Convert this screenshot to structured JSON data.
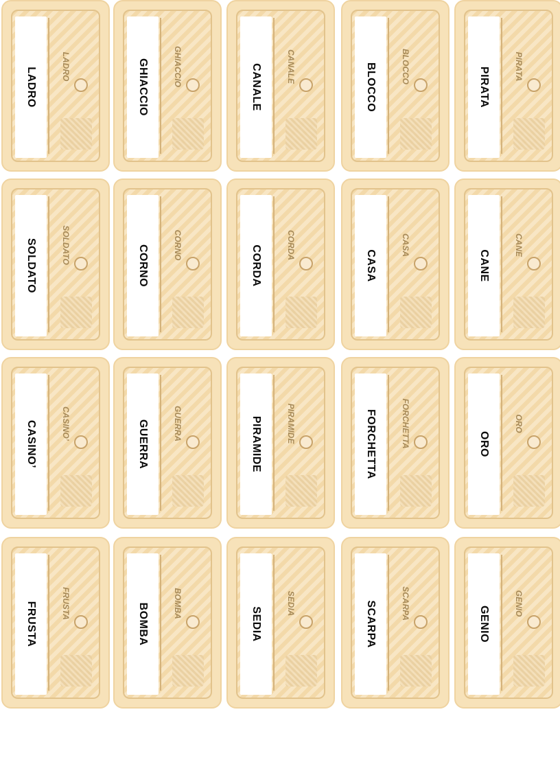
{
  "card_colors": {
    "card_background": "#f7e2b9",
    "card_border": "#e2c38c",
    "small_text": "#a68957",
    "main_text": "#0a0a0a"
  },
  "cards": [
    [
      "LADRO",
      "GHIACCIO",
      "CANALE",
      "BLOCCO",
      "PIRATA"
    ],
    [
      "SOLDATO",
      "CORNO",
      "CORDA",
      "CASA",
      "CANE"
    ],
    [
      "CASINO’",
      "GUERRA",
      "PIRAMIDE",
      "FORCHETTA",
      "ORO"
    ],
    [
      "FRUSTA",
      "BOMBA",
      "SEDIA",
      "SCARPA",
      "GENIO"
    ]
  ]
}
